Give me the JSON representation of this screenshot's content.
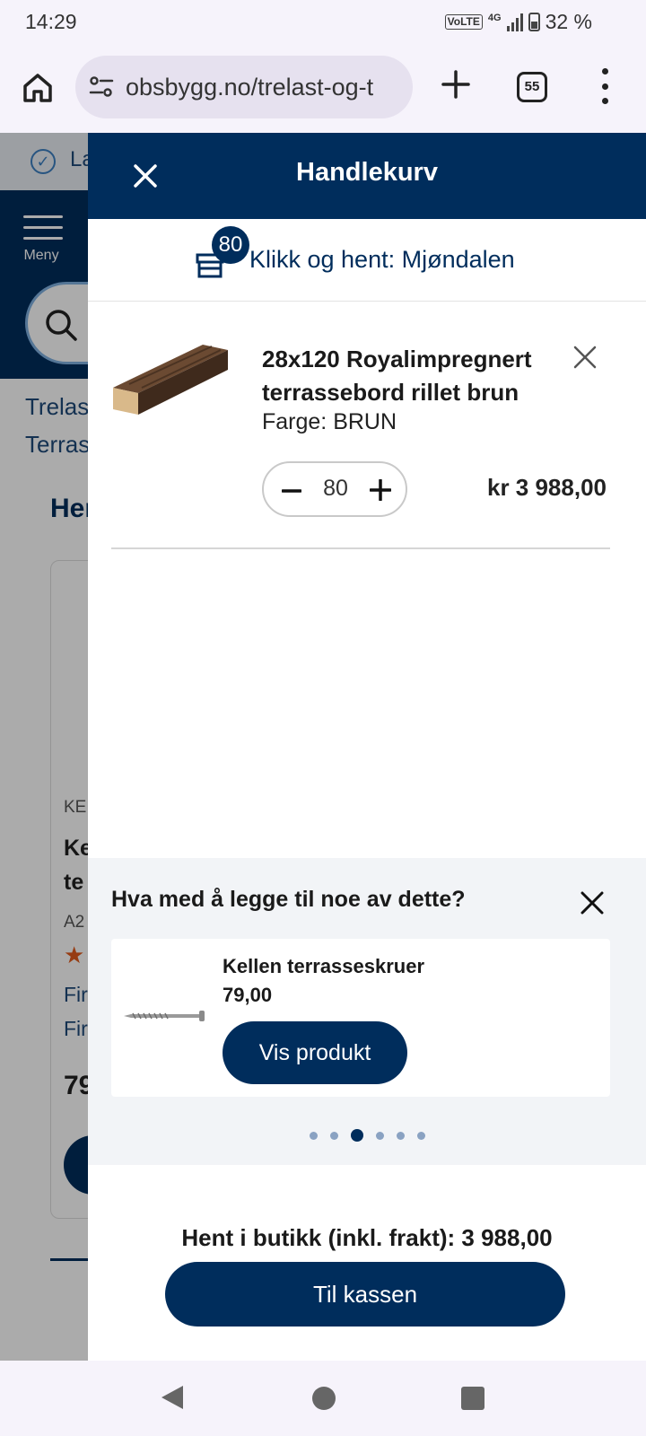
{
  "status_bar": {
    "time": "14:29",
    "volte": "VoLTE",
    "network": "4G",
    "battery": "32 %"
  },
  "browser": {
    "url": "obsbygg.no/trelast-og-t",
    "tab_count": "55",
    "icons": [
      "home-icon",
      "site-settings-icon",
      "new-tab-icon",
      "tabs-icon",
      "more-icon"
    ]
  },
  "background_page": {
    "banner_text": "La",
    "menu_label": "Meny",
    "breadcrumb_1": "Trelas",
    "breadcrumb_2": "Terras",
    "heading": "Her",
    "card_brand": "KE",
    "card_title_1": "Ke",
    "card_title_2": "te",
    "card_sku": "A2",
    "card_link_1": "Fir",
    "card_link_2": "Fir",
    "card_price": "79",
    "star_color": "#e05a1c"
  },
  "cart": {
    "title": "Handlekurv",
    "store_badge": "80",
    "store_label": "Klikk og hent: Mjøndalen",
    "item": {
      "name": "28x120 Royalimpregnert terrassebord rillet brun",
      "color": "Farge: BRUN",
      "quantity": "80",
      "price": "kr 3 988,00"
    },
    "recommendations": {
      "title": "Hva med å legge til noe av dette?",
      "product_name": "Kellen terrasseskruer",
      "product_price": "79,00",
      "button_label": "Vis produkt",
      "dot_count": 6,
      "active_dot": 2
    },
    "total": "Hent i butikk (inkl. frakt): 3 988,00",
    "checkout_label": "Til kassen"
  },
  "colors": {
    "brand_navy": "#002d5c",
    "overlay": "rgba(0,0,0,0.33)"
  }
}
